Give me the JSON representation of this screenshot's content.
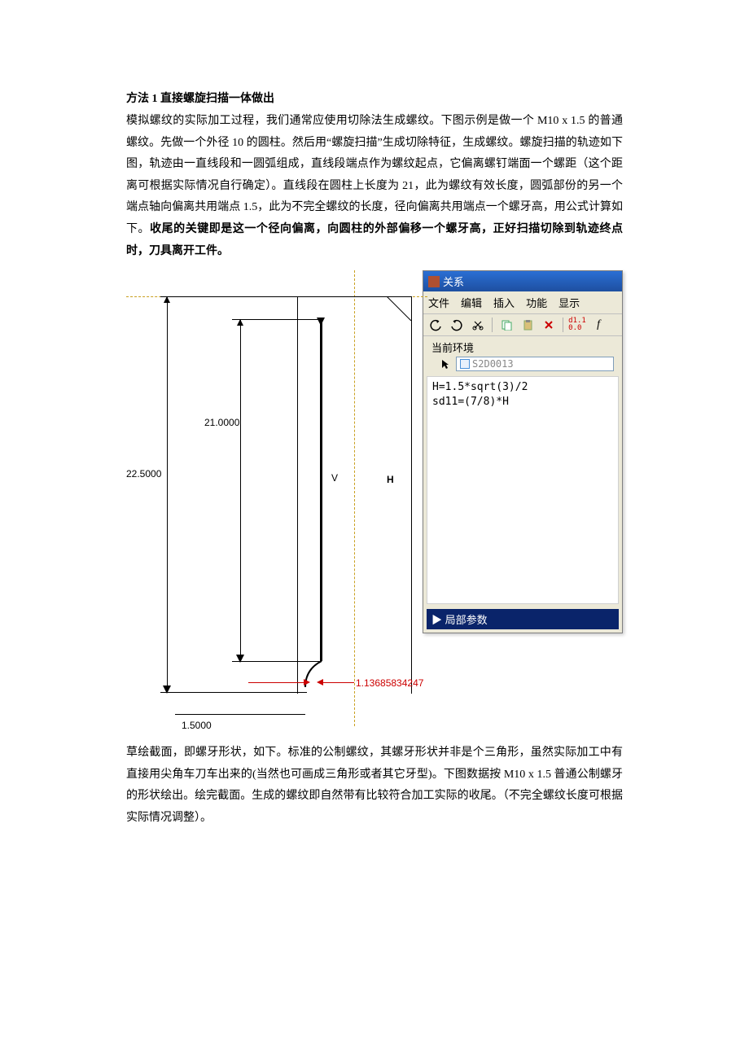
{
  "heading": "方法 1  直接螺旋扫描一体做出",
  "para1": "模拟螺纹的实际加工过程，我们通常应使用切除法生成螺纹。下图示例是做一个 M10 x 1.5 的普通螺纹。先做一个外径 10 的圆柱。然后用“螺旋扫描”生成切除特征，生成螺纹。螺旋扫描的轨迹如下图，轨迹由一直线段和一圆弧组成，直线段端点作为螺纹起点，它偏离螺钉端面一个螺距（这个距离可根据实际情况自行确定）。直线段在圆柱上长度为 21，此为螺纹有效长度，圆弧部份的另一个端点轴向偏离共用端点 1.5，此为不完全螺纹的长度，径向偏离共用端点一个螺牙高，用公式计算如下。",
  "para1_bold": "收尾的关键即是这一个径向偏离，向圆柱的外部偏移一个螺牙高，正好扫描切除到轨迹终点时，刀具离开工件。",
  "para2": "草绘截面，即螺牙形状，如下。标准的公制螺纹，其螺牙形状并非是个三角形，虽然实际加工中有直接用尖角车刀车出来的(当然也可画成三角形或者其它牙型)。下图数据按 M10 x 1.5 普通公制螺牙的形状绘出。绘完截面。生成的螺纹即自然带有比较符合加工实际的收尾。（不完全螺纹长度可根据实际情况调整）。",
  "sketch": {
    "dim_22_5": "22.5000",
    "dim_21": "21.0000",
    "dim_1_5": "1.5000",
    "dim_radial": "1.13685834247",
    "v": "V",
    "h": "H"
  },
  "panel": {
    "title": "关系",
    "menu": {
      "file": "文件",
      "edit": "编辑",
      "insert": "插入",
      "func": "功能",
      "show": "显示"
    },
    "env_label": "当前环境",
    "env_value": "S2D0013",
    "formula1": "H=1.5*sqrt(3)/2",
    "formula2": "sd11=(7/8)*H",
    "local_params": "▶ 局部参数"
  }
}
